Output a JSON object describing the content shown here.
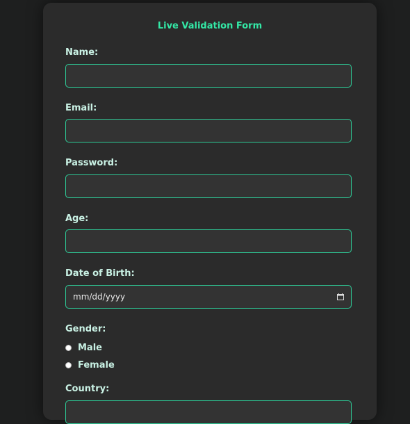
{
  "form": {
    "title": "Live Validation Form",
    "fields": {
      "name": {
        "label": "Name:",
        "value": ""
      },
      "email": {
        "label": "Email:",
        "value": ""
      },
      "password": {
        "label": "Password:",
        "value": ""
      },
      "age": {
        "label": "Age:",
        "value": ""
      },
      "dob": {
        "label": "Date of Birth:",
        "placeholder": "mm/dd/yyyy",
        "icon": "calendar-icon"
      }
    },
    "gender": {
      "label": "Gender:",
      "options": [
        "Male",
        "Female"
      ]
    },
    "country": {
      "label": "Country:"
    }
  },
  "colors": {
    "accent": "#33e8a6",
    "label": "#c9f1e4",
    "card": "#2b2b2b",
    "background": "#1e1f1f",
    "input_bg": "#333333",
    "border": "#2ecc98"
  }
}
